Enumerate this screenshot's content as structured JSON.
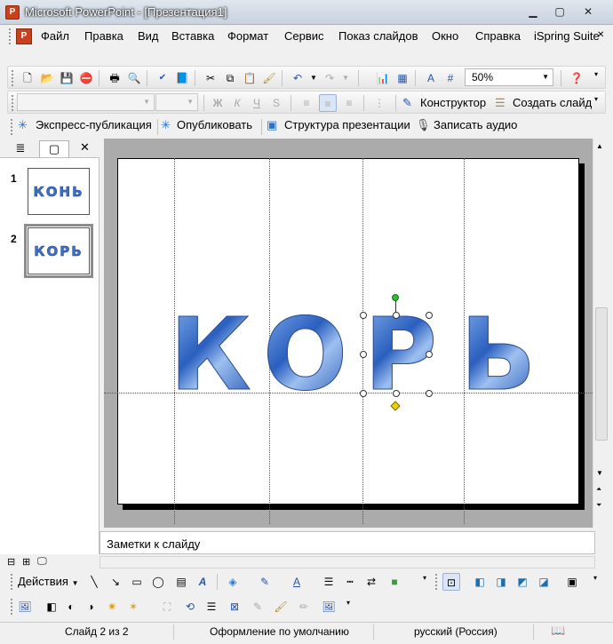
{
  "window": {
    "title": "Microsoft PowerPoint - [Презентация1]"
  },
  "menu": {
    "items": [
      "Файл",
      "Правка",
      "Вид",
      "Вставка",
      "Формат",
      "Сервис",
      "Показ слайдов",
      "Окно",
      "Справка",
      "iSpring Suite"
    ]
  },
  "toolbar": {
    "zoom": "50%"
  },
  "format_toolbar": {
    "designer": "Конструктор",
    "new_slide": "Создать слайд"
  },
  "ispring_toolbar": {
    "express": "Экспресс-публикация",
    "publish": "Опубликовать",
    "structure": "Структура презентации",
    "record": "Записать аудио"
  },
  "slides_panel": {
    "thumbs": [
      {
        "number": "1",
        "text": "КОНЬ"
      },
      {
        "number": "2",
        "text": "КОРЬ"
      }
    ]
  },
  "slide": {
    "letters": [
      "К",
      "О",
      "Р",
      "Ь"
    ]
  },
  "notes": {
    "placeholder": "Заметки к слайду"
  },
  "drawing": {
    "actions": "Действия"
  },
  "status": {
    "slide": "Слайд 2 из 2",
    "design": "Оформление по умолчанию",
    "language": "русский (Россия)"
  },
  "colors": {
    "accent": "#3f77cf",
    "title_bar": "#c9d3df"
  }
}
